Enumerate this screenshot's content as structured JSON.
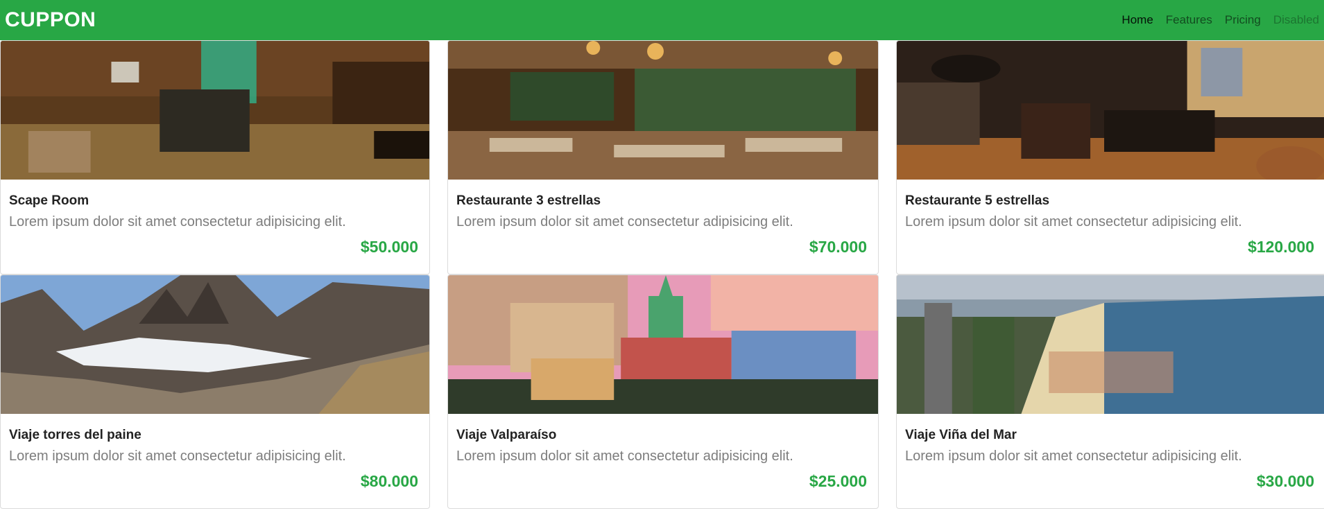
{
  "navbar": {
    "brand": "CUPPON",
    "links": [
      {
        "label": "Home",
        "state": "active"
      },
      {
        "label": "Features",
        "state": "normal"
      },
      {
        "label": "Pricing",
        "state": "normal"
      },
      {
        "label": "Disabled",
        "state": "disabled"
      }
    ]
  },
  "colors": {
    "brand": "#28a745",
    "price": "#28a745"
  },
  "cards": [
    {
      "title": "Scape Room",
      "text": "Lorem ipsum dolor sit amet consectetur adipisicing elit.",
      "price": "$50.000"
    },
    {
      "title": "Restaurante 3 estrellas",
      "text": "Lorem ipsum dolor sit amet consectetur adipisicing elit.",
      "price": "$70.000"
    },
    {
      "title": "Restaurante 5 estrellas",
      "text": "Lorem ipsum dolor sit amet consectetur adipisicing elit.",
      "price": "$120.000"
    },
    {
      "title": "Viaje torres del paine",
      "text": "Lorem ipsum dolor sit amet consectetur adipisicing elit.",
      "price": "$80.000"
    },
    {
      "title": "Viaje Valparaíso",
      "text": "Lorem ipsum dolor sit amet consectetur adipisicing elit.",
      "price": "$25.000"
    },
    {
      "title": "Viaje Viña del Mar",
      "text": "Lorem ipsum dolor sit amet consectetur adipisicing elit.",
      "price": "$30.000"
    }
  ]
}
